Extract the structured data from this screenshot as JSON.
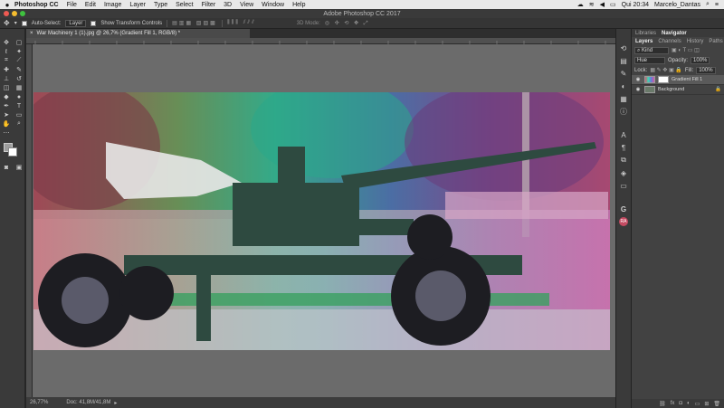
{
  "menubar": {
    "app": "Photoshop CC",
    "items": [
      "File",
      "Edit",
      "Image",
      "Layer",
      "Type",
      "Select",
      "Filter",
      "3D",
      "View",
      "Window",
      "Help"
    ],
    "clock": "Qui 20:34",
    "user": "Marcelo_Dantas"
  },
  "window": {
    "title": "Adobe Photoshop CC 2017"
  },
  "options": {
    "auto_select": "Auto-Select:",
    "auto_select_target": "Layer",
    "show_transform": "Show Transform Controls",
    "mode_3d": "3D Mode:"
  },
  "document": {
    "tab_title": "War Machinery 1 (1).jpg @ 26,7% (Gradient Fill 1, RGB/8) *",
    "close": "×"
  },
  "status": {
    "zoom": "26,77%",
    "doc": "Doc: 41,8M/41,8M"
  },
  "panels": {
    "top_tabs": [
      "Libraries",
      "Navigator"
    ],
    "layer_tabs": [
      "Layers",
      "Channels",
      "History",
      "Paths"
    ],
    "kind": "Kind",
    "blend": "Hue",
    "opacity_label": "Opacity:",
    "opacity": "100%",
    "lock_label": "Lock:",
    "fill_label": "Fill:",
    "fill": "100%",
    "layers": [
      {
        "name": "Gradient Fill 1",
        "selected": true
      },
      {
        "name": "Background",
        "selected": false
      }
    ],
    "footer": [
      "fx"
    ]
  },
  "colors": {
    "accent_swatch_red": "#c44b62",
    "gradient": [
      "#d05a6e",
      "#3fd4b0",
      "#6a78d8",
      "#d05aa0"
    ]
  }
}
